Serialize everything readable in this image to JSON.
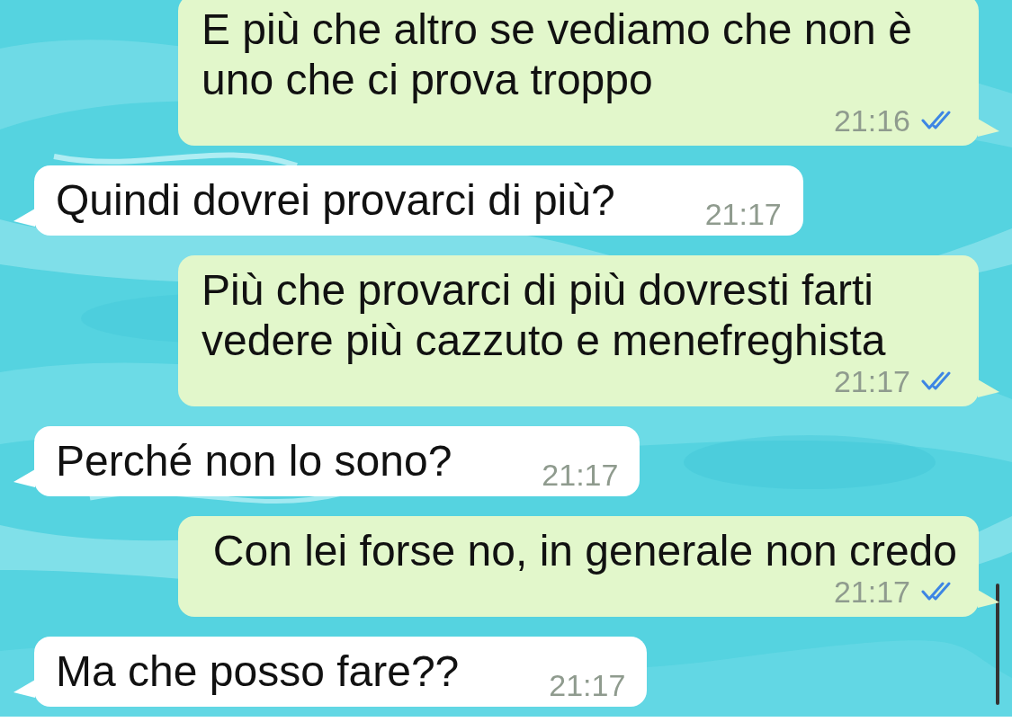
{
  "messages": [
    {
      "kind": "outgoing",
      "text": "E più che altro se vediamo che non è uno che ci prova troppo",
      "time": "21:16",
      "read": true
    },
    {
      "kind": "incoming",
      "text": "Quindi dovrei provarci di più?",
      "time": "21:17"
    },
    {
      "kind": "outgoing",
      "text": "Più che provarci di più dovresti farti vedere più cazzuto e menefreghista",
      "time": "21:17",
      "read": true
    },
    {
      "kind": "incoming",
      "text": "Perché non lo sono?",
      "time": "21:17"
    },
    {
      "kind": "outgoing",
      "text": "Con lei forse no, in generale non credo",
      "time": "21:17",
      "read": true
    },
    {
      "kind": "incoming",
      "text": "Ma che posso fare??",
      "time": "21:17"
    }
  ]
}
